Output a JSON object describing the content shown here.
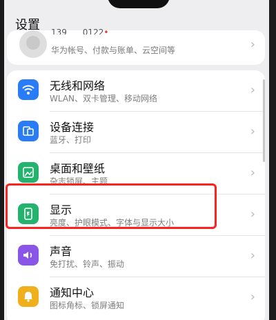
{
  "header": {
    "title": "设置"
  },
  "account": {
    "line1": "139",
    "line1b": "0122",
    "subtitle": "华为帐号、付款与账单、云空间等"
  },
  "settings_items": [
    {
      "title": "无线和网络",
      "subtitle": "WLAN、双卡管理、移动网络",
      "icon": "wifi-icon",
      "color": "#2a7cf6"
    },
    {
      "title": "设备连接",
      "subtitle": "蓝牙、打印",
      "icon": "device-connection-icon",
      "color": "#2a7cf6"
    },
    {
      "title": "桌面和壁纸",
      "subtitle": "杂志锁屏、主题",
      "icon": "wallpaper-icon",
      "color": "#23b36e"
    },
    {
      "title": "显示",
      "subtitle": "亮度、护眼模式、字体与显示大小",
      "icon": "display-icon",
      "color": "#23b36e"
    },
    {
      "title": "声音",
      "subtitle": "免打扰、铃声、振动",
      "icon": "sound-icon",
      "color": "#8a56e8"
    },
    {
      "title": "通知中心",
      "subtitle": "图标角标、锁屏通知",
      "icon": "notification-icon",
      "color": "#f0b01d"
    }
  ],
  "chevron": "›",
  "highlight_color": "#ff2020"
}
